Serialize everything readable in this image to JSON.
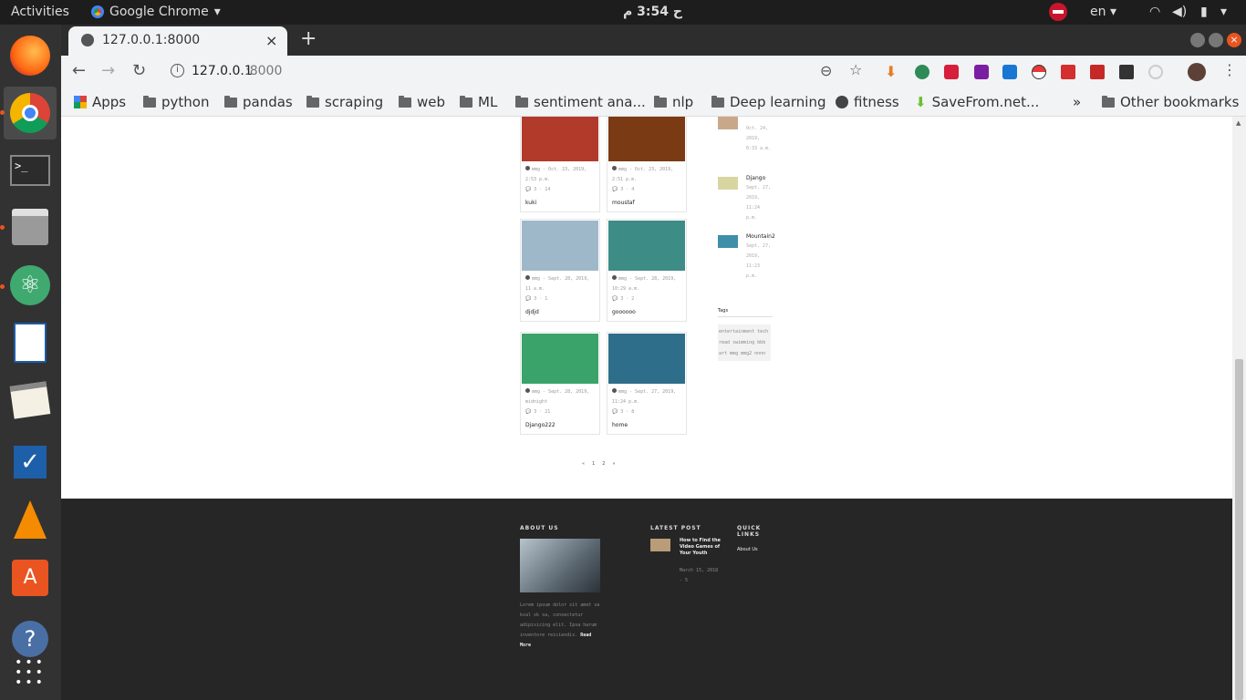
{
  "topbar": {
    "activities": "Activities",
    "app": "Google Chrome",
    "clock": "ح 3:54 م",
    "lang": "en"
  },
  "dock": [
    "firefox-icon",
    "chrome-icon",
    "terminal-icon",
    "files-icon",
    "atom-icon",
    "libreoffice-draw-icon",
    "text-editor-icon",
    "tasks-icon",
    "vlc-icon",
    "software-center-icon",
    "help-icon",
    "app-grid-icon"
  ],
  "tab": {
    "title": "127.0.0.1:8000",
    "close": "×",
    "new": "+"
  },
  "address": {
    "host": "127.0.0.1",
    "port": ":8000"
  },
  "bookmarks": {
    "apps": "Apps",
    "items": [
      "python",
      "pandas",
      "scraping",
      "web",
      "ML",
      "sentiment ana...",
      "nlp",
      "Deep learning"
    ],
    "fitness": "fitness",
    "savefrom": "SaveFrom.net...",
    "more": "»",
    "other": "Other bookmarks"
  },
  "posts": [
    {
      "meta": "mmg - Oct. 23, 2019, 2:53 p.m.",
      "stats": "3 · 14",
      "title": "kuki",
      "color": "#b23a2a"
    },
    {
      "meta": "mmg - Oct. 23, 2019, 2:51 p.m.",
      "stats": "3 · 4",
      "title": "moustaf",
      "color": "#7a3a14"
    },
    {
      "meta": "mmg - Sept. 28, 2019, 11 a.m.",
      "stats": "3 · 1",
      "title": "djdjd",
      "color": "#9fb8c9"
    },
    {
      "meta": "mmg - Sept. 28, 2019, 10:29 a.m.",
      "stats": "3 · 2",
      "title": "goooooo",
      "color": "#3e8c86"
    },
    {
      "meta": "mmg - Sept. 28, 2019, midnight",
      "stats": "3 · 21",
      "title": "Django222",
      "color": "#3aa36a"
    },
    {
      "meta": "mmg - Sept. 27, 2019, 11:24 p.m.",
      "stats": "3 · 8",
      "title": "home",
      "color": "#2f6e8a"
    }
  ],
  "sidebar": {
    "recent": [
      {
        "title": "",
        "date": "Oct. 24, 2019, 0:33 a.m.",
        "color": "#c9a88a"
      },
      {
        "title": "Django",
        "date": "Sept. 27, 2019, 11:24 p.m.",
        "color": "#d8d6a0"
      },
      {
        "title": "Mountain2",
        "date": "Sept. 27, 2019, 11:23 p.m.",
        "color": "#3f8fa8"
      }
    ],
    "tags_title": "Tags",
    "tags": [
      "entertainment",
      "tech",
      "read",
      "swimming",
      "bbb",
      "art",
      "mmg",
      "mmg2",
      "nnnn"
    ]
  },
  "pagination": [
    "«",
    "1",
    "2",
    "»"
  ],
  "footer": {
    "about_title": "ABOUT US",
    "about_text": "Lorem ipsum dolor sit amet sa ksal sk sa, consectetur adipisicing elit. Ipsa harum inventore reiciendis.",
    "read_more": "Read More",
    "latest_title": "LATEST POST",
    "latest_post": "How to Find the Video Games of Your Youth",
    "latest_date": "March 15, 2018",
    "latest_comments": "- 5",
    "quick_title": "QUICK LINKS",
    "quick_link": "About Us"
  }
}
